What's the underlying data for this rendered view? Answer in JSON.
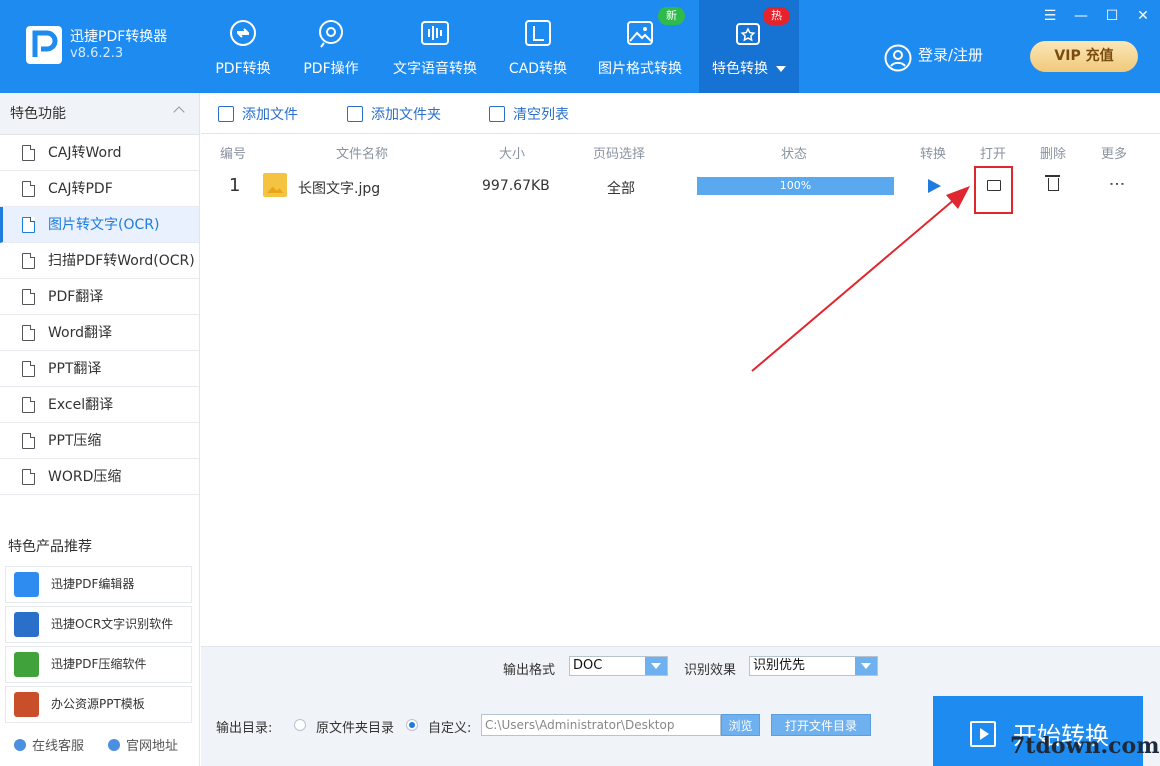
{
  "app": {
    "name": "迅捷PDF转换器",
    "version": "v8.6.2.3"
  },
  "nav": [
    {
      "label": "PDF转换",
      "icon": "pdf-convert-icon"
    },
    {
      "label": "PDF操作",
      "icon": "pdf-operate-icon"
    },
    {
      "label": "文字语音转换",
      "icon": "audio-icon"
    },
    {
      "label": "CAD转换",
      "icon": "cad-icon"
    },
    {
      "label": "图片格式转换",
      "icon": "image-icon",
      "badge": "新"
    },
    {
      "label": "特色转换",
      "icon": "special-icon",
      "badge": "热"
    }
  ],
  "header": {
    "login": "登录/注册",
    "vip": "VIP 充值"
  },
  "sidebar": {
    "title": "特色功能",
    "items": [
      {
        "label": "CAJ转Word"
      },
      {
        "label": "CAJ转PDF"
      },
      {
        "label": "图片转文字(OCR)"
      },
      {
        "label": "扫描PDF转Word(OCR)"
      },
      {
        "label": "PDF翻译"
      },
      {
        "label": "Word翻译"
      },
      {
        "label": "PPT翻译"
      },
      {
        "label": "Excel翻译"
      },
      {
        "label": "PPT压缩"
      },
      {
        "label": "WORD压缩"
      }
    ],
    "products_title": "特色产品推荐",
    "products": [
      {
        "label": "迅捷PDF编辑器"
      },
      {
        "label": "迅捷OCR文字识别软件"
      },
      {
        "label": "迅捷PDF压缩软件"
      },
      {
        "label": "办公资源PPT模板"
      }
    ],
    "footer": {
      "service": "在线客服",
      "website": "官网地址"
    }
  },
  "toolbar": {
    "add_file": "添加文件",
    "add_folder": "添加文件夹",
    "clear": "清空列表"
  },
  "table": {
    "headers": {
      "num": "编号",
      "name": "文件名称",
      "size": "大小",
      "pages": "页码选择",
      "status": "状态",
      "convert": "转换",
      "open": "打开",
      "delete": "删除",
      "more": "更多"
    },
    "rows": [
      {
        "num": "1",
        "name": "长图文字.jpg",
        "size": "997.67KB",
        "pages": "全部",
        "progress": 1.0,
        "progress_text": "100%"
      }
    ]
  },
  "bottom": {
    "format_label": "输出格式",
    "format_value": "DOC",
    "ocr_label": "识别效果",
    "ocr_value": "识别优先",
    "output_label": "输出目录:",
    "option_source": "原文件夹目录",
    "option_custom": "自定义:",
    "path": "C:\\Users\\Administrator\\Desktop",
    "browse": "浏览",
    "open_dir": "打开文件目录",
    "start": "开始转换"
  },
  "watermark": "7tdown.com",
  "colors": {
    "brand": "#1e8bf0",
    "highlight": "#e0262e",
    "progress": "#5aa9ef"
  }
}
